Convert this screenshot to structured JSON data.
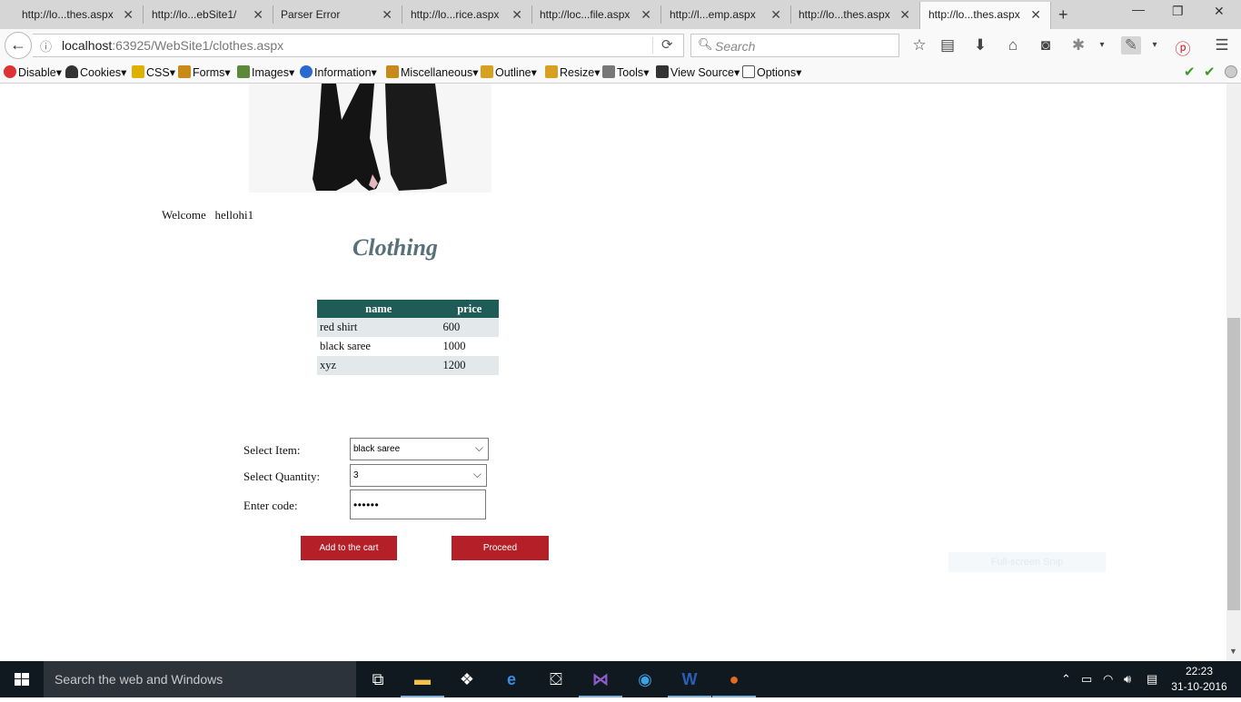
{
  "browser": {
    "tabs": [
      {
        "label": "http://lo...thes.aspx",
        "active": false
      },
      {
        "label": "http://lo...ebSite1/",
        "active": false
      },
      {
        "label": "Parser Error",
        "active": false
      },
      {
        "label": "http://lo...rice.aspx",
        "active": false
      },
      {
        "label": "http://loc...file.aspx",
        "active": false
      },
      {
        "label": "http://l...emp.aspx",
        "active": false
      },
      {
        "label": "http://lo...thes.aspx",
        "active": false
      },
      {
        "label": "http://lo...thes.aspx",
        "active": true
      }
    ],
    "url_host": "localhost",
    "url_path": ":63925/WebSite1/clothes.aspx",
    "search_placeholder": "Search"
  },
  "toolbar": {
    "items": [
      {
        "label": "Disable",
        "icon": "disable-icon",
        "color": "#d33"
      },
      {
        "label": "Cookies",
        "icon": "cookies-icon",
        "color": "#333"
      },
      {
        "label": "CSS",
        "icon": "css-icon",
        "color": "#e0b000"
      },
      {
        "label": "Forms",
        "icon": "forms-icon",
        "color": "#c98a1a"
      },
      {
        "label": "Images",
        "icon": "images-icon",
        "color": "#5a8a3a"
      },
      {
        "label": "Information",
        "icon": "information-icon",
        "color": "#2a6ad0"
      },
      {
        "label": "Miscellaneous",
        "icon": "miscellaneous-icon",
        "color": "#c98a1a"
      },
      {
        "label": "Outline",
        "icon": "outline-icon",
        "color": "#d8a020"
      },
      {
        "label": "Resize",
        "icon": "resize-icon",
        "color": "#d8a020"
      },
      {
        "label": "Tools",
        "icon": "tools-icon",
        "color": "#777"
      },
      {
        "label": "View Source",
        "icon": "view-source-icon",
        "color": "#333"
      },
      {
        "label": "Options",
        "icon": "options-icon",
        "color": "#555"
      }
    ]
  },
  "page": {
    "welcome_label": "Welcome",
    "username": "hellohi1",
    "title": "Clothing",
    "table": {
      "headers": [
        "name",
        "price"
      ],
      "rows": [
        [
          "red shirt",
          "600"
        ],
        [
          "black saree",
          "1000"
        ],
        [
          "xyz",
          "1200"
        ]
      ]
    },
    "form": {
      "select_item_label": "Select Item:",
      "select_item_value": "black saree",
      "select_quantity_label": "Select Quantity:",
      "select_quantity_value": "3",
      "code_label": "Enter code:",
      "code_value": "••••••"
    },
    "buttons": {
      "add_to_cart": "Add to the cart",
      "proceed": "Proceed"
    },
    "overlay": "Full-screen Snip"
  },
  "taskbar": {
    "search_placeholder": "Search the web and Windows",
    "time": "22:23",
    "date": "31-10-2016"
  },
  "colors": {
    "table_header": "#1f5b57",
    "title": "#57707a",
    "button": "#b41f28"
  }
}
